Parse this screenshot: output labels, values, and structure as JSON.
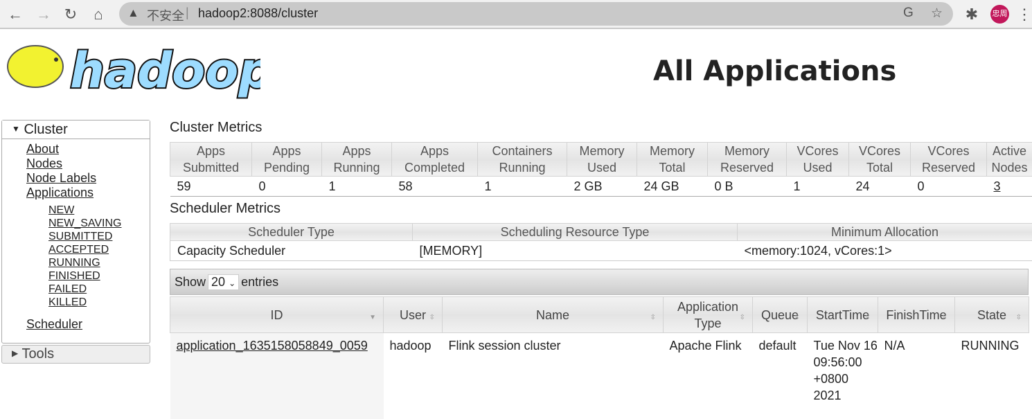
{
  "browser": {
    "insecure_label": "不安全",
    "url": "hadoop2:8088/cluster",
    "avatar": "忠周"
  },
  "logo_text": "hadoop",
  "page_title": "All Applications",
  "sidebar": {
    "cluster": "Cluster",
    "items": [
      "About",
      "Nodes",
      "Node Labels",
      "Applications"
    ],
    "states": [
      "NEW",
      "NEW_SAVING",
      "SUBMITTED",
      "ACCEPTED",
      "RUNNING",
      "FINISHED",
      "FAILED",
      "KILLED"
    ],
    "scheduler": "Scheduler",
    "tools": "Tools"
  },
  "cluster_metrics": {
    "title": "Cluster Metrics",
    "headers": [
      [
        "Apps",
        "Submitted"
      ],
      [
        "Apps",
        "Pending"
      ],
      [
        "Apps",
        "Running"
      ],
      [
        "Apps",
        "Completed"
      ],
      [
        "Containers",
        "Running"
      ],
      [
        "Memory",
        "Used"
      ],
      [
        "Memory",
        "Total"
      ],
      [
        "Memory",
        "Reserved"
      ],
      [
        "VCores",
        "Used"
      ],
      [
        "VCores",
        "Total"
      ],
      [
        "VCores",
        "Reserved"
      ],
      [
        "Active",
        "Nodes"
      ]
    ],
    "values": [
      "59",
      "0",
      "1",
      "58",
      "1",
      "2 GB",
      "24 GB",
      "0 B",
      "1",
      "24",
      "0",
      "3"
    ]
  },
  "scheduler_metrics": {
    "title": "Scheduler Metrics",
    "headers": [
      "Scheduler Type",
      "Scheduling Resource Type",
      "Minimum Allocation"
    ],
    "values": [
      "Capacity Scheduler",
      "[MEMORY]",
      "<memory:1024, vCores:1>"
    ]
  },
  "apps": {
    "show": "Show",
    "page_size": "20",
    "entries": "entries",
    "headers": [
      "ID",
      "User",
      "Name",
      "Application Type",
      "Queue",
      "StartTime",
      "FinishTime",
      "State"
    ],
    "rows": [
      {
        "id": "application_1635158058849_0059",
        "user": "hadoop",
        "name": "Flink session cluster",
        "type": "Apache Flink",
        "queue": "default",
        "start": "Tue Nov 16 09:56:00 +0800 2021",
        "finish": "N/A",
        "state": "RUNNING"
      }
    ]
  }
}
